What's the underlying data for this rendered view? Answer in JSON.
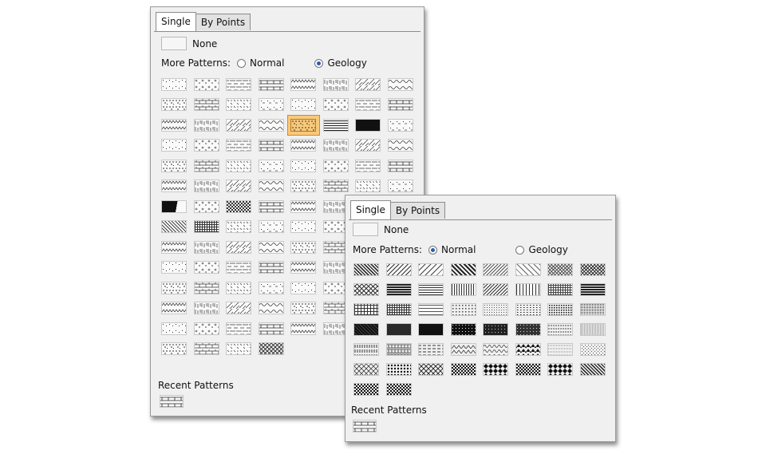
{
  "geology_dialog": {
    "tabs": [
      {
        "label": "Single",
        "active": true
      },
      {
        "label": "By Points",
        "active": false
      }
    ],
    "none_label": "None",
    "more_patterns_label": "More Patterns:",
    "radio_normal": {
      "label": "Normal",
      "selected": false
    },
    "radio_geology": {
      "label": "Geology",
      "selected": true
    },
    "grid": {
      "columns": 8,
      "rows": 14,
      "count": 108,
      "selected_index": 20
    },
    "recent_label": "Recent Patterns"
  },
  "normal_dialog": {
    "tabs": [
      {
        "label": "Single",
        "active": true
      },
      {
        "label": "By Points",
        "active": false
      }
    ],
    "none_label": "None",
    "more_patterns_label": "More Patterns:",
    "radio_normal": {
      "label": "Normal",
      "selected": true
    },
    "radio_geology": {
      "label": "Geology",
      "selected": false
    },
    "grid": {
      "columns": 8,
      "rows": 7,
      "count": 50
    },
    "recent_label": "Recent Patterns"
  },
  "colors": {
    "panel_bg": "#f0f0f0",
    "selection": "#f9c97a",
    "radio_dot": "#2a5db0"
  }
}
